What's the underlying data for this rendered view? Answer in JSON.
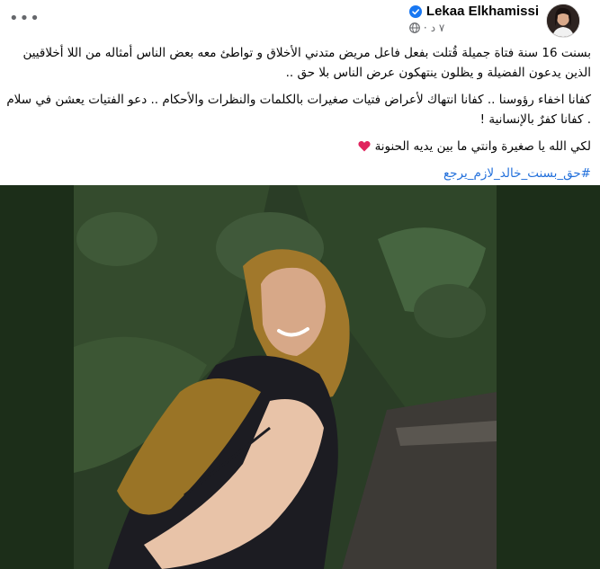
{
  "post": {
    "author": "Lekaa Elkhamissi",
    "time": "٧ د",
    "separator": "·",
    "more_label": "•••",
    "paragraphs": [
      "بسنت 16 سنة فتاة جميلة قُتلت بفعل فاعل مريض متدني الأخلاق و تواطئ معه بعض الناس أمثاله من اللا أخلاقيين الذين يدعون الفضيلة و يظلون ينتهكون عرض الناس بلا حق ..",
      "كفانا اخفاء رؤوسنا .. كفانا انتهاك لأعراض فتيات صغيرات بالكلمات والنظرات والأحكام .. دعو الفتيات يعشن في سلام . كفانا كفرٌ بالإنسانية !",
      "لكي الله يا صغيرة وانتي ما بين يديه الحنونة"
    ],
    "hashtag": "#حق_بسنت_خالد_لازم_يرجع",
    "colors": {
      "link": "#216fdb",
      "verified": "#1877f2",
      "heart": "#e0245e"
    },
    "icons": [
      "verified-badge-icon",
      "globe-icon",
      "heart-icon",
      "more-options-icon"
    ]
  }
}
